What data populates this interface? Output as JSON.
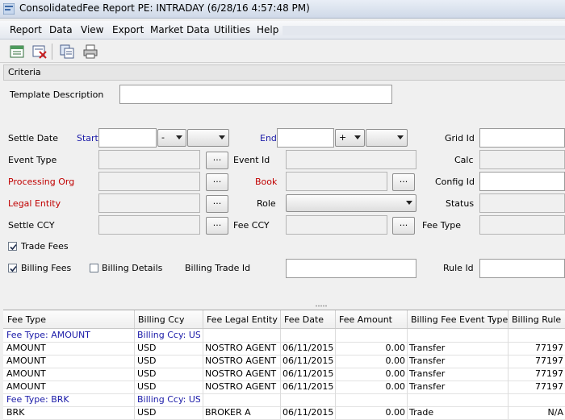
{
  "window": {
    "title": "ConsolidatedFee Report PE: INTRADAY (6/28/16 4:57:48 PM)"
  },
  "menu": [
    "Report",
    "Data",
    "View",
    "Export",
    "Market Data",
    "Utilities",
    "Help"
  ],
  "toolbar": {
    "icons": [
      "new-report-icon",
      "delete-report-icon",
      "copy-icon",
      "print-icon"
    ]
  },
  "criteria": {
    "header": "Criteria",
    "template_description_label": "Template Description",
    "template_description_value": "",
    "settle_date_label": "Settle Date",
    "start_label": "Start",
    "start_sign": "-",
    "end_label": "End",
    "end_sign": "+",
    "grid_id_label": "Grid Id",
    "event_type_label": "Event Type",
    "event_id_label": "Event Id",
    "calc_label": "Calc",
    "processing_org_label": "Processing Org",
    "book_label": "Book",
    "config_id_label": "Config Id",
    "legal_entity_label": "Legal Entity",
    "role_label": "Role",
    "status_label": "Status",
    "settle_ccy_label": "Settle CCY",
    "fee_ccy_label": "Fee CCY",
    "fee_type_label": "Fee Type",
    "dots": "...",
    "trade_fees_label": "Trade Fees",
    "trade_fees_checked": true,
    "billing_fees_label": "Billing Fees",
    "billing_fees_checked": true,
    "billing_details_label": "Billing Details",
    "billing_details_checked": false,
    "billing_trade_id_label": "Billing Trade Id",
    "rule_id_label": "Rule Id"
  },
  "table": {
    "columns": [
      "Fee Type",
      "Billing Ccy",
      "Fee Legal Entity",
      "Fee Date",
      "Fee Amount",
      "Billing Fee Event Type",
      "Billing Rule"
    ],
    "rows": [
      {
        "group": true,
        "cells": [
          "Fee Type: AMOUNT",
          "Billing Ccy: USD",
          "",
          "",
          "",
          "",
          ""
        ]
      },
      {
        "group": false,
        "cells": [
          "AMOUNT",
          "USD",
          "NOSTRO AGENT",
          "06/11/2015",
          "0.00",
          "Transfer",
          "77197"
        ]
      },
      {
        "group": false,
        "cells": [
          "AMOUNT",
          "USD",
          "NOSTRO AGENT",
          "06/11/2015",
          "0.00",
          "Transfer",
          "77197"
        ]
      },
      {
        "group": false,
        "cells": [
          "AMOUNT",
          "USD",
          "NOSTRO AGENT",
          "06/11/2015",
          "0.00",
          "Transfer",
          "77197"
        ]
      },
      {
        "group": false,
        "cells": [
          "AMOUNT",
          "USD",
          "NOSTRO AGENT",
          "06/11/2015",
          "0.00",
          "Transfer",
          "77197"
        ]
      },
      {
        "group": true,
        "cells": [
          "Fee Type: BRK",
          "Billing Ccy: USD",
          "",
          "",
          "",
          "",
          ""
        ]
      },
      {
        "group": false,
        "cells": [
          "BRK",
          "USD",
          "BROKER A",
          "06/11/2015",
          "0.00",
          "Trade",
          "N/A"
        ]
      }
    ]
  }
}
